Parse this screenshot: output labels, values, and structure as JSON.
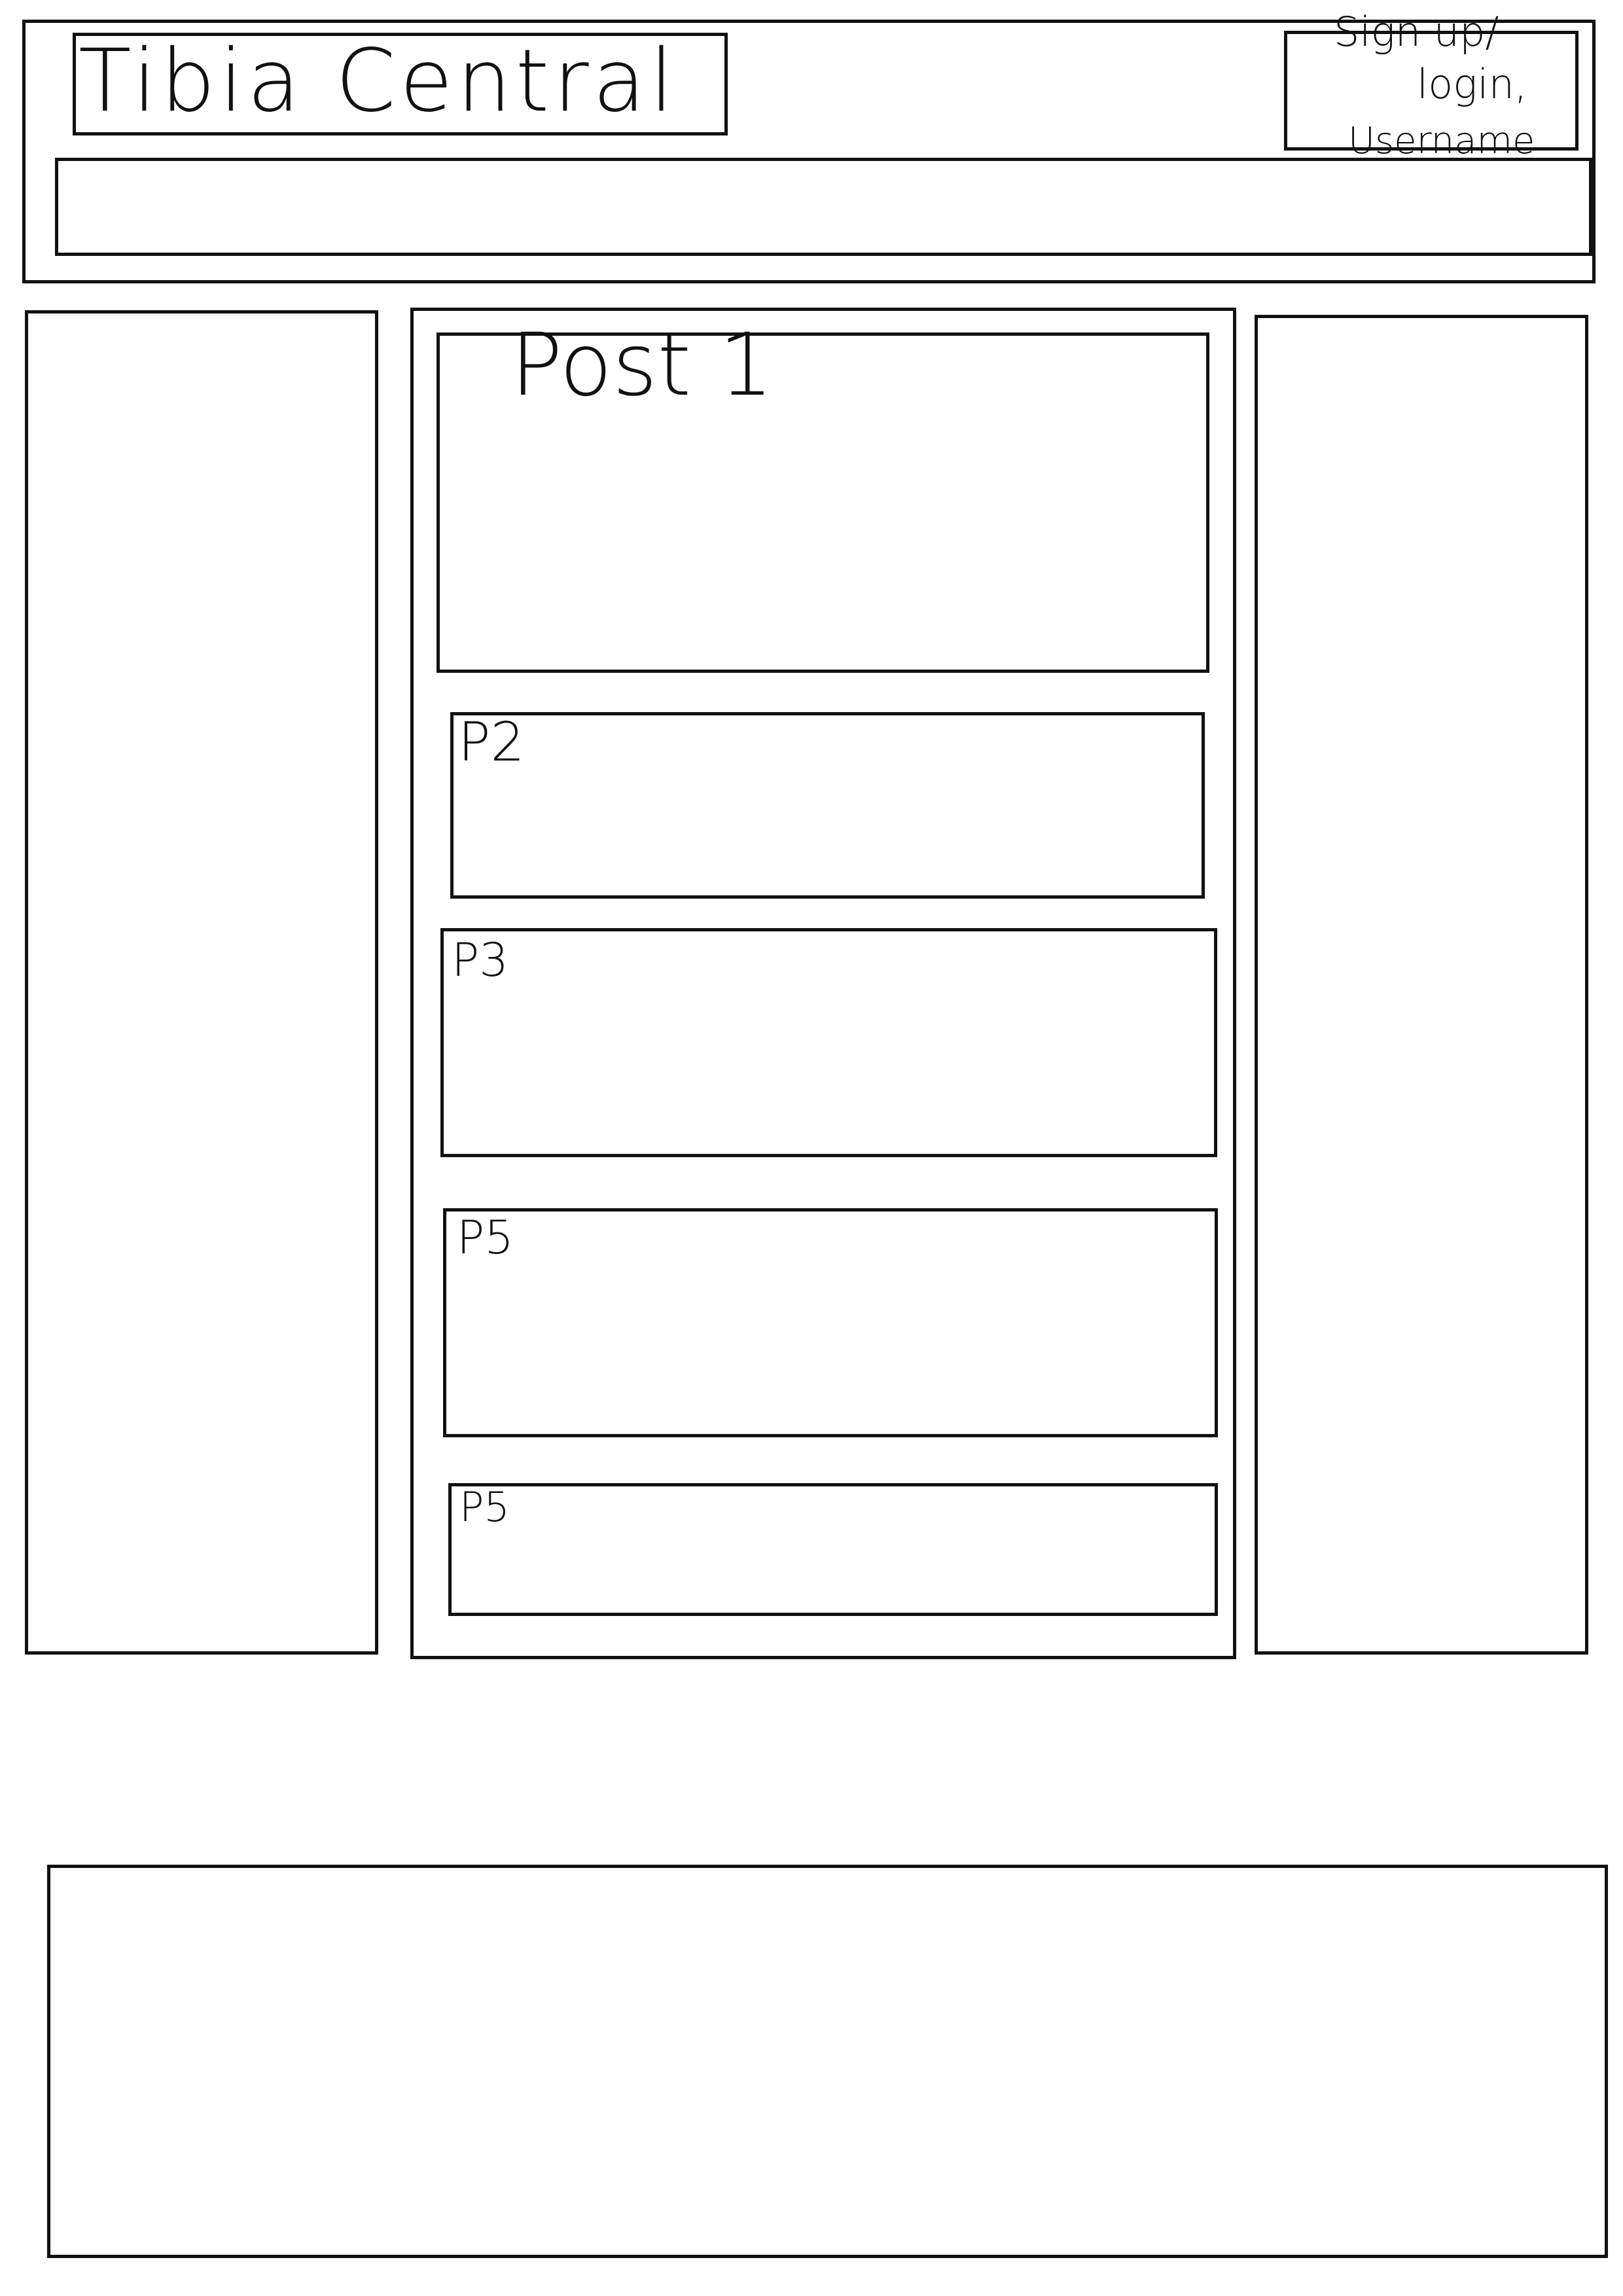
{
  "header": {
    "logo_text": "Tibia Central",
    "auth": {
      "line1": "Sign up/",
      "line2": "login,",
      "line3": "Username"
    }
  },
  "feed": {
    "posts": [
      {
        "label": "Post 1"
      },
      {
        "label": "P2"
      },
      {
        "label": "P3"
      },
      {
        "label": "P5"
      },
      {
        "label": "P5"
      }
    ]
  }
}
